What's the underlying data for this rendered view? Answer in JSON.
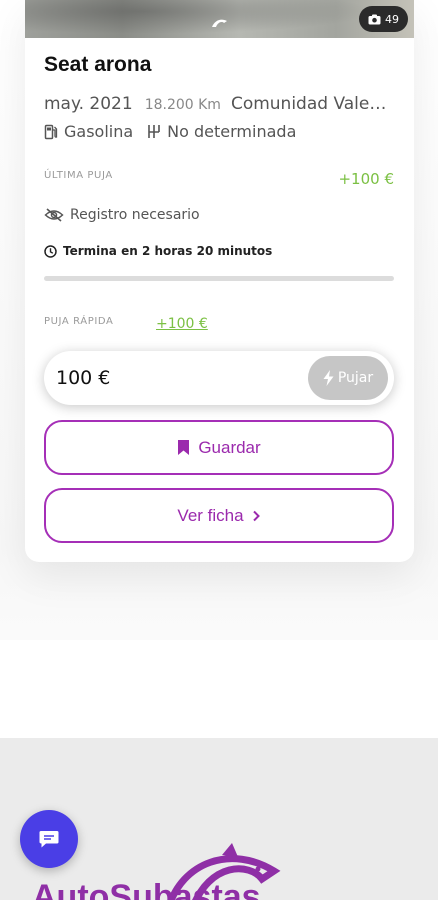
{
  "listing": {
    "photo_count": "49",
    "watermark": "AutoSubastas",
    "title": "Seat arona",
    "date": "may. 2021",
    "km": "18.200 Km",
    "location": "Comunidad Valenciana",
    "fuel": "Gasolina",
    "transmission": "No determinada"
  },
  "bid": {
    "last_label": "ÚLTIMA PUJA",
    "last_value": "+100 €",
    "registration": "Registro necesario",
    "ends": "Termina en 2 horas 20 minutos",
    "progress": 0,
    "quick_label": "PUJA RÁPIDA",
    "quick_value": "+100 €",
    "input_value": "100 €",
    "pujar_label": "Pujar"
  },
  "actions": {
    "save_label": "Guardar",
    "view_label": "Ver ficha"
  },
  "footer": {
    "logo_text": "AutoSubastas"
  },
  "colors": {
    "accent": "#9b2aad",
    "positive": "#7bc043",
    "chat": "#4a3ee6"
  }
}
